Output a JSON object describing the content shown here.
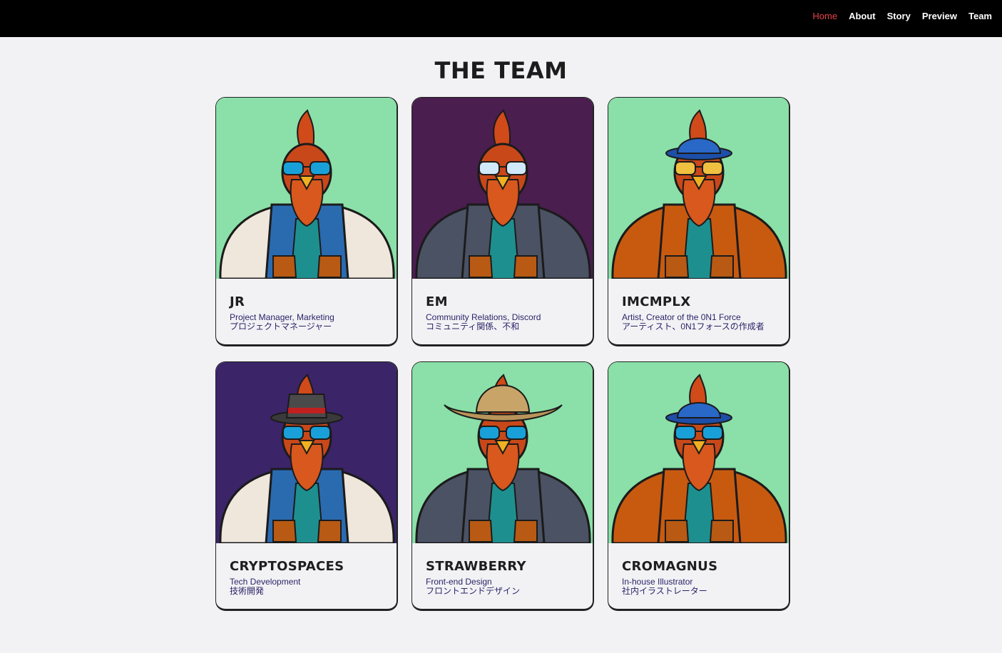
{
  "nav": {
    "items": [
      {
        "label": "Home",
        "active": true
      },
      {
        "label": "About"
      },
      {
        "label": "Story"
      },
      {
        "label": "Preview"
      },
      {
        "label": "Team"
      }
    ]
  },
  "page_title": "THE TEAM",
  "team": [
    {
      "name": "JR",
      "role": "Project Manager, Marketing",
      "role_jp": "プロジェクトマネージャー",
      "bg": "#8ae0a8",
      "jacket": "#2a6bb0",
      "sleeve": "#efe6dc",
      "headwear": "none",
      "glasses": "#1aa0d8"
    },
    {
      "name": "EM",
      "role": "Community Relations, Discord",
      "role_jp": "コミュニティ関係、不和",
      "bg": "#4a1e4e",
      "jacket": "#4a5264",
      "sleeve": "#4a5264",
      "headwear": "none",
      "glasses": "#d0e8f8"
    },
    {
      "name": "IMCMPLX",
      "role": "Artist, Creator of the 0N1 Force",
      "role_jp": "アーティスト、0N1フォースの作成者",
      "bg": "#8ae0a8",
      "jacket": "#c85a10",
      "sleeve": "#c85a10",
      "headwear": "cap",
      "glasses": "#f0c040"
    },
    {
      "name": "CRYPTOSPACES",
      "role": "Tech Development",
      "role_jp": "技術開発",
      "bg": "#3b2468",
      "jacket": "#2a6bb0",
      "sleeve": "#efe6dc",
      "headwear": "fedora",
      "glasses": "#1aa0d8"
    },
    {
      "name": "STRAWBERRY",
      "role": "Front-end Design",
      "role_jp": "フロントエンドデザイン",
      "bg": "#8ae0a8",
      "jacket": "#4a5264",
      "sleeve": "#4a5264",
      "headwear": "cowboy",
      "glasses": "#1aa0d8"
    },
    {
      "name": "CROMAGNUS",
      "role": "In-house Illustrator",
      "role_jp": "社内イラストレーター",
      "bg": "#8ae0a8",
      "jacket": "#c85a10",
      "sleeve": "#c85a10",
      "headwear": "cap",
      "glasses": "#1aa0d8"
    }
  ]
}
